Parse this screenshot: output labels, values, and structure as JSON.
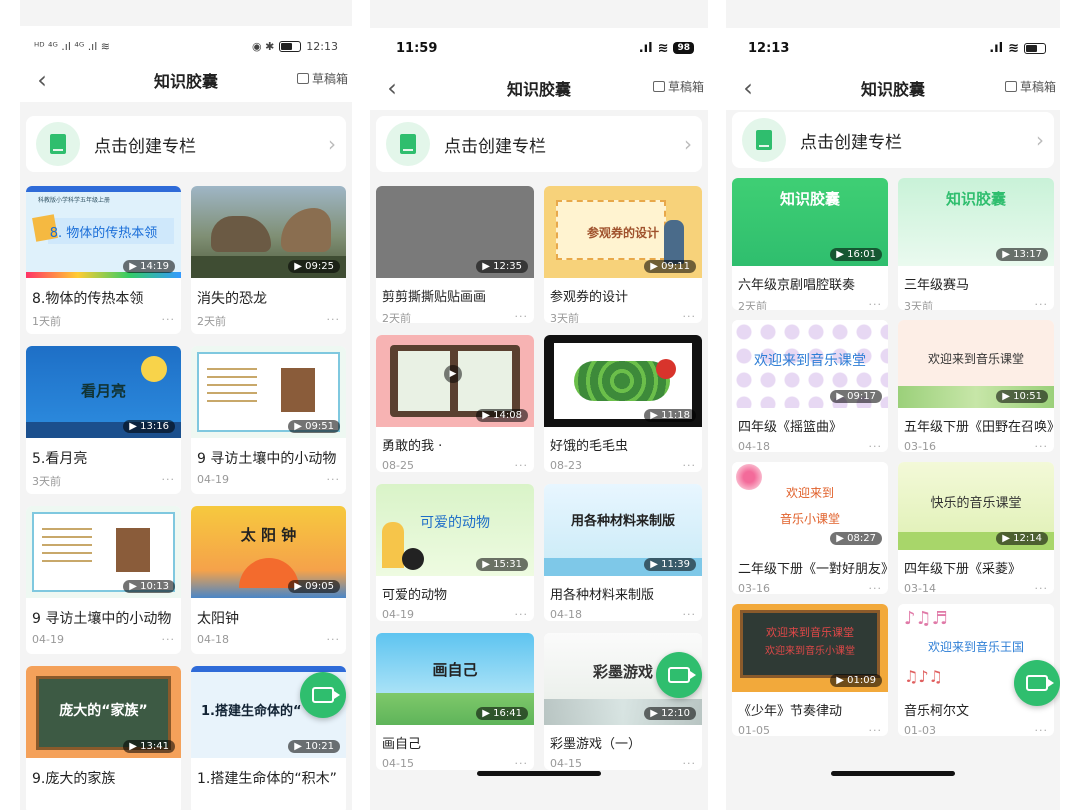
{
  "nav": {
    "title": "知识胶囊",
    "drafts": "草稿箱"
  },
  "create_label": "点击创建专栏",
  "screens": [
    {
      "status": {
        "left": "ᴴᴰ ⁴ᴳ .ıl ⁴ᴳ .ıl ≋",
        "right": "◉ ✱",
        "time": "12:13"
      },
      "cards": [
        {
          "title": "8.物体的传热本领",
          "meta": "1天前",
          "duration": "14:19",
          "thumb_text": "8. 物体的传热本领"
        },
        {
          "title": "消失的恐龙",
          "meta": "2天前",
          "duration": "09:25",
          "thumb_text": ""
        },
        {
          "title": "5.看月亮",
          "meta": "3天前",
          "duration": "13:16",
          "thumb_text": "看月亮"
        },
        {
          "title": "9 寻访土壤中的小动物",
          "meta": "04-19",
          "duration": "09:51",
          "thumb_text": ""
        },
        {
          "title": "9 寻访土壤中的小动物",
          "meta": "04-19",
          "duration": "10:13",
          "thumb_text": ""
        },
        {
          "title": "太阳钟",
          "meta": "04-18",
          "duration": "09:05",
          "thumb_text": "太 阳 钟"
        },
        {
          "title": "9.庞大的家族",
          "meta": "",
          "duration": "13:41",
          "thumb_text": "庞大的“家族”"
        },
        {
          "title": "1.搭建生命体的“积木”",
          "meta": "",
          "duration": "10:21",
          "thumb_text": "1.搭建生命体的“"
        }
      ]
    },
    {
      "status": {
        "time": "11:59",
        "battery": "98"
      },
      "cards": [
        {
          "title": "剪剪撕撕贴贴画画",
          "meta": "2天前",
          "duration": "12:35",
          "thumb_text": ""
        },
        {
          "title": "参观券的设计",
          "meta": "3天前",
          "duration": "09:11",
          "thumb_text": "参观券的设计"
        },
        {
          "title": "勇敢的我 ·",
          "meta": "08-25",
          "duration": "14:08",
          "thumb_text": ""
        },
        {
          "title": "好饿的毛毛虫",
          "meta": "08-23",
          "duration": "11:18",
          "thumb_text": ""
        },
        {
          "title": "可爱的动物",
          "meta": "04-19",
          "duration": "15:31",
          "thumb_text": "可爱的动物"
        },
        {
          "title": "用各种材料来制版",
          "meta": "04-18",
          "duration": "11:39",
          "thumb_text": "用各种材料来制版"
        },
        {
          "title": "画自己",
          "meta": "04-15",
          "duration": "16:41",
          "thumb_text": "画自己"
        },
        {
          "title": "彩墨游戏（一）",
          "meta": "04-15",
          "duration": "12:10",
          "thumb_text": "彩墨游戏"
        }
      ]
    },
    {
      "status": {
        "time": "12:13"
      },
      "cards": [
        {
          "title": "六年级京剧唱腔联奏",
          "meta": "2天前",
          "duration": "16:01",
          "thumb_text": "知识胶囊"
        },
        {
          "title": "三年级赛马",
          "meta": "3天前",
          "duration": "13:17",
          "thumb_text": "知识胶囊"
        },
        {
          "title": "四年级《摇篮曲》",
          "meta": "04-18",
          "duration": "09:17",
          "thumb_text": "欢迎来到音乐课堂"
        },
        {
          "title": "五年级下册《田野在召唤》",
          "meta": "03-16",
          "duration": "10:51",
          "thumb_text": "欢迎来到音乐课堂"
        },
        {
          "title": "二年级下册《一對好朋友》",
          "meta": "03-16",
          "duration": "08:27",
          "thumb_text": "欢迎来到"
        },
        {
          "title": "四年级下册《采菱》",
          "meta": "03-14",
          "duration": "12:14",
          "thumb_text": "快乐的音乐课堂"
        },
        {
          "title": "《少年》节奏律动",
          "meta": "01-05",
          "duration": "01:09",
          "thumb_text": "欢迎来到音乐课堂"
        },
        {
          "title": "音乐柯尔文",
          "meta": "01-03",
          "duration": "",
          "thumb_text": "欢迎来到音乐王国"
        }
      ]
    }
  ],
  "extra_text": {
    "s1_c1_sub": "科教版小学科学五年级上册",
    "s3_c5_sub": "音乐小课堂",
    "s3_c7_sub": "欢迎来到音乐小课堂"
  },
  "colors": {
    "accent": "#2fbe6e"
  },
  "icons": [
    "back-arrow-icon",
    "drafts-icon",
    "book-icon",
    "chevron-right-icon",
    "video-camera-icon",
    "play-icon"
  ]
}
